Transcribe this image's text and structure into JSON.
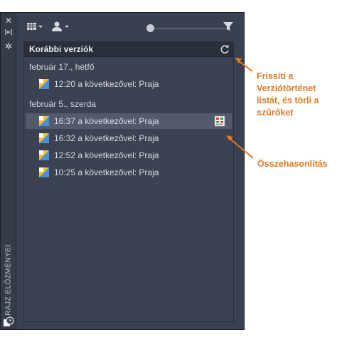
{
  "palette": {
    "side_title": "RAJZ ELŐZMÉNYEI",
    "side_buttons": [
      "close-icon",
      "auto-hide-icon",
      "properties-icon"
    ],
    "toolbar": {
      "calendar_icon": "calendar-filter-icon",
      "user_icon": "user-filter-icon",
      "filter_icon": "funnel-icon",
      "slider_value": 0
    },
    "header": {
      "title": "Korábbi verziók",
      "refresh_icon": "refresh-icon"
    },
    "groups": [
      {
        "date": "február 17., hétfő",
        "versions": [
          {
            "label": "12:20 a következővel: Praja"
          }
        ]
      },
      {
        "date": "február 5., szerda",
        "versions": [
          {
            "label": "16:37 a következővel: Praja",
            "selected": true
          },
          {
            "label": "16:32 a következővel: Praja"
          },
          {
            "label": "12:52 a következővel: Praja"
          },
          {
            "label": "10:25 a következővel: Praja"
          }
        ]
      }
    ]
  },
  "callouts": {
    "refresh": [
      "Frissíti a",
      "Verziótörténet",
      "listát, és törli a",
      "szűrőket"
    ],
    "compare": "Összehasonlítás"
  },
  "colors": {
    "accent": "#e07b22",
    "panel": "#3a4050",
    "selected_row": "#535a6b"
  }
}
